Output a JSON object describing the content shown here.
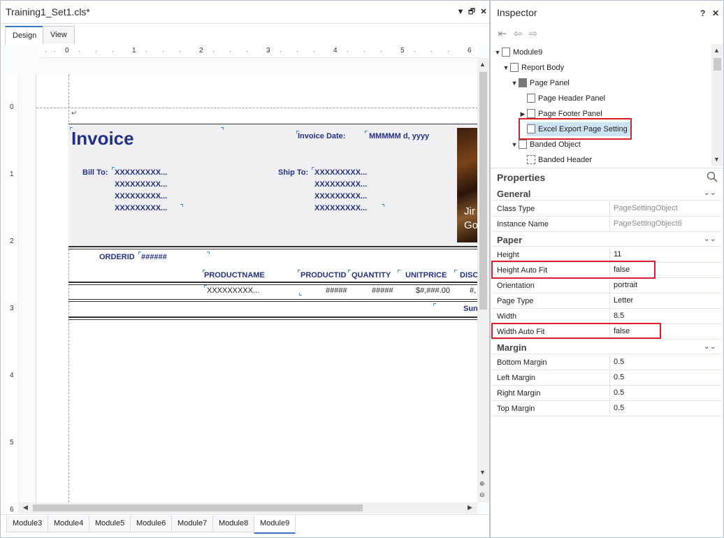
{
  "document": {
    "title": "Training1_Set1.cls*",
    "view_tabs": [
      "Design",
      "View"
    ],
    "module_tabs": [
      "Module3",
      "Module4",
      "Module5",
      "Module6",
      "Module7",
      "Module8",
      "Module9"
    ],
    "active_module": "Module9"
  },
  "ruler": {
    "top": [
      "0",
      "1",
      "2",
      "3",
      "4",
      "5",
      "6"
    ],
    "left": [
      "0",
      "1",
      "2",
      "3",
      "4",
      "5",
      "6"
    ]
  },
  "report": {
    "paragraph_mark": "↵",
    "title": "Invoice",
    "invoice_date_label": "Invoice Date:",
    "invoice_date_value": "MMMMM d, yyyy",
    "bill_to_label": "Bill To:",
    "ship_to_label": "Ship To:",
    "placeholder": "XXXXXXXXX...",
    "logo_text": "Jir\nGo",
    "orderid_label": "ORDERID",
    "orderid_value": "######",
    "columns": [
      "PRODUCTNAME",
      "PRODUCTID",
      "QUANTITY",
      "UNITPRICE",
      "DISC"
    ],
    "detail_values": [
      "XXXXXXXXX...",
      "#####",
      "#####",
      "$#,###.00",
      "#,"
    ],
    "sum_label": "Sun"
  },
  "inspector": {
    "title": "Inspector",
    "help_label": "?",
    "tree": [
      {
        "label": "Module9"
      },
      {
        "label": "Report Body"
      },
      {
        "label": "Page Panel"
      },
      {
        "label": "Page Header Panel"
      },
      {
        "label": "Page Footer Panel"
      },
      {
        "label": "Excel Export Page Setting"
      },
      {
        "label": "Banded Object"
      },
      {
        "label": "Banded Header"
      }
    ],
    "properties_title": "Properties",
    "categories": {
      "general": "General",
      "paper": "Paper",
      "margin": "Margin"
    },
    "properties": {
      "general": [
        {
          "name": "Class Type",
          "value": "PageSettingObject"
        },
        {
          "name": "Instance Name",
          "value": "PageSettingObject6"
        }
      ],
      "paper": [
        {
          "name": "Height",
          "value": "11"
        },
        {
          "name": "Height Auto Fit",
          "value": "false"
        },
        {
          "name": "Orientation",
          "value": "portrait"
        },
        {
          "name": "Page Type",
          "value": "Letter"
        },
        {
          "name": "Width",
          "value": "8.5"
        },
        {
          "name": "Width Auto Fit",
          "value": "false"
        }
      ],
      "margin": [
        {
          "name": "Bottom Margin",
          "value": "0.5"
        },
        {
          "name": "Left Margin",
          "value": "0.5"
        },
        {
          "name": "Right Margin",
          "value": "0.5"
        },
        {
          "name": "Top Margin",
          "value": "0.5"
        }
      ]
    }
  },
  "colors": {
    "report_text": "#23308a",
    "highlight": "#d7202a",
    "selection": "#cde3f6",
    "accent": "#3a78c2"
  }
}
